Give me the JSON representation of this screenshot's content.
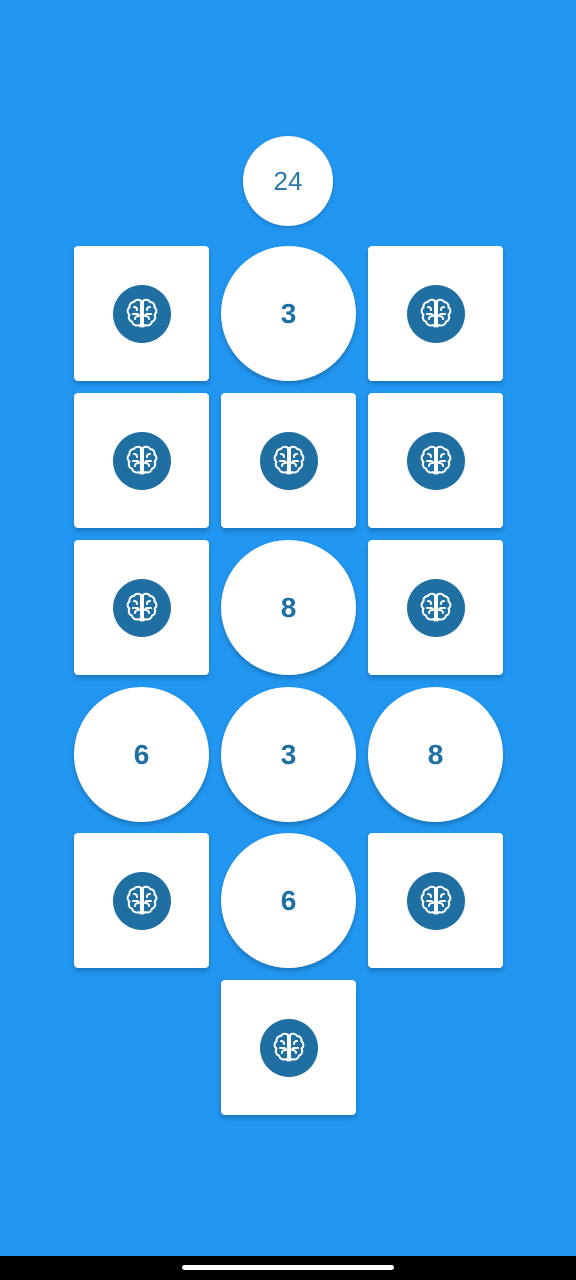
{
  "score": "24",
  "colors": {
    "background": "#2196f0",
    "tile": "#ffffff",
    "accent": "#1f6fa3"
  },
  "tiles": [
    {
      "state": "hidden",
      "icon": "brain-icon"
    },
    {
      "state": "revealed",
      "value": "3"
    },
    {
      "state": "hidden",
      "icon": "brain-icon"
    },
    {
      "state": "hidden",
      "icon": "brain-icon"
    },
    {
      "state": "hidden",
      "icon": "brain-icon"
    },
    {
      "state": "hidden",
      "icon": "brain-icon"
    },
    {
      "state": "hidden",
      "icon": "brain-icon"
    },
    {
      "state": "revealed",
      "value": "8"
    },
    {
      "state": "hidden",
      "icon": "brain-icon"
    },
    {
      "state": "revealed",
      "value": "6"
    },
    {
      "state": "revealed",
      "value": "3"
    },
    {
      "state": "revealed",
      "value": "8"
    },
    {
      "state": "hidden",
      "icon": "brain-icon"
    },
    {
      "state": "revealed",
      "value": "6"
    },
    {
      "state": "hidden",
      "icon": "brain-icon"
    },
    {
      "state": "hidden",
      "icon": "brain-icon"
    }
  ]
}
